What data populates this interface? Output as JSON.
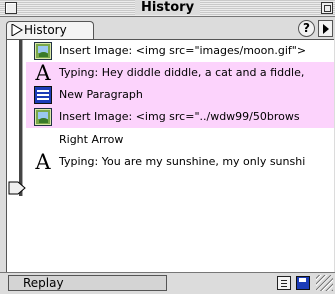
{
  "window": {
    "title": "History"
  },
  "tab": {
    "label": "History"
  },
  "help": {
    "label": "?"
  },
  "history": {
    "items": [
      {
        "icon": "insert-image-icon",
        "text": "Insert Image: <img src=\"images/moon.gif\">"
      },
      {
        "icon": "typing-icon",
        "text": "Typing: Hey diddle diddle, a cat and a fiddle,"
      },
      {
        "icon": "new-paragraph-icon",
        "text": "New Paragraph"
      },
      {
        "icon": "insert-image-icon",
        "text": "Insert Image: <img src=\"../wdw99/50brows"
      },
      {
        "icon": "",
        "text": "Right Arrow"
      },
      {
        "icon": "typing-icon",
        "text": "Typing: You are my sunshine, my only sunshi"
      }
    ]
  },
  "bottom": {
    "replay_label": "Replay"
  },
  "colors": {
    "selection": "#fcd3fc",
    "paragraph_icon": "#1c3cb8"
  }
}
